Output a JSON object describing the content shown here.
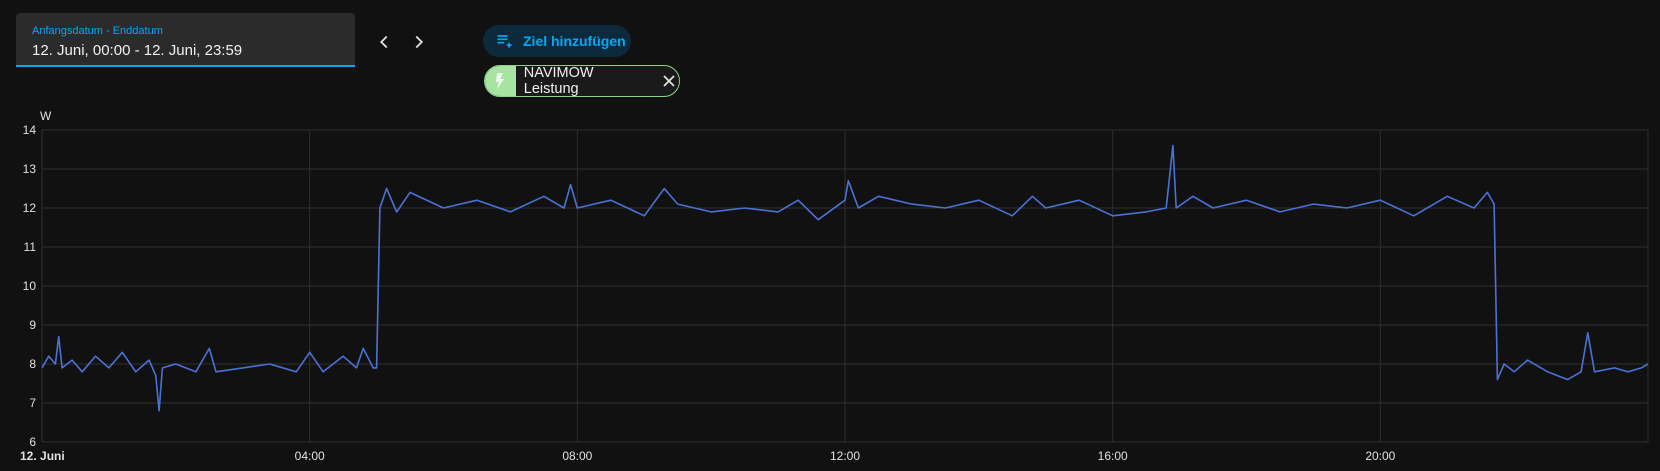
{
  "date_range": {
    "label": "Anfangsdatum - Enddatum",
    "value": "12. Juni, 00:00 - 12. Juni, 23:59"
  },
  "toolbar": {
    "add_target_label": "Ziel hinzufügen"
  },
  "entity_chip": {
    "label": "NAVIMOW Leistung",
    "color": "#a7e3a2"
  },
  "colors": {
    "accent": "#03a9f4",
    "series": "#4a72d6",
    "grid": "#2e2e2e"
  },
  "chart_data": {
    "type": "line",
    "ylabel": "W",
    "ylim": [
      6,
      14
    ],
    "yticks": [
      "6",
      "7",
      "8",
      "9",
      "10",
      "11",
      "12",
      "13",
      "14"
    ],
    "xlim": [
      0,
      24
    ],
    "xticks": [
      {
        "hour": 0,
        "label": "12. Juni",
        "bold": true
      },
      {
        "hour": 4,
        "label": "04:00"
      },
      {
        "hour": 8,
        "label": "08:00"
      },
      {
        "hour": 12,
        "label": "12:00"
      },
      {
        "hour": 16,
        "label": "16:00"
      },
      {
        "hour": 20,
        "label": "20:00"
      }
    ],
    "grid": true,
    "series": [
      {
        "values": [
          [
            0.0,
            7.9
          ],
          [
            0.1,
            8.2
          ],
          [
            0.2,
            8.0
          ],
          [
            0.25,
            8.7
          ],
          [
            0.3,
            7.9
          ],
          [
            0.45,
            8.1
          ],
          [
            0.6,
            7.8
          ],
          [
            0.8,
            8.2
          ],
          [
            1.0,
            7.9
          ],
          [
            1.2,
            8.3
          ],
          [
            1.4,
            7.8
          ],
          [
            1.6,
            8.1
          ],
          [
            1.7,
            7.7
          ],
          [
            1.75,
            6.8
          ],
          [
            1.8,
            7.9
          ],
          [
            2.0,
            8.0
          ],
          [
            2.3,
            7.8
          ],
          [
            2.5,
            8.4
          ],
          [
            2.6,
            7.8
          ],
          [
            3.0,
            7.9
          ],
          [
            3.4,
            8.0
          ],
          [
            3.8,
            7.8
          ],
          [
            4.0,
            8.3
          ],
          [
            4.2,
            7.8
          ],
          [
            4.5,
            8.2
          ],
          [
            4.7,
            7.9
          ],
          [
            4.8,
            8.4
          ],
          [
            4.95,
            7.9
          ],
          [
            5.0,
            7.9
          ],
          [
            5.05,
            12.0
          ],
          [
            5.15,
            12.5
          ],
          [
            5.3,
            11.9
          ],
          [
            5.5,
            12.4
          ],
          [
            6.0,
            12.0
          ],
          [
            6.5,
            12.2
          ],
          [
            7.0,
            11.9
          ],
          [
            7.5,
            12.3
          ],
          [
            7.8,
            12.0
          ],
          [
            7.9,
            12.6
          ],
          [
            8.0,
            12.0
          ],
          [
            8.5,
            12.2
          ],
          [
            9.0,
            11.8
          ],
          [
            9.3,
            12.5
          ],
          [
            9.5,
            12.1
          ],
          [
            10.0,
            11.9
          ],
          [
            10.5,
            12.0
          ],
          [
            11.0,
            11.9
          ],
          [
            11.3,
            12.2
          ],
          [
            11.6,
            11.7
          ],
          [
            12.0,
            12.2
          ],
          [
            12.05,
            12.7
          ],
          [
            12.2,
            12.0
          ],
          [
            12.5,
            12.3
          ],
          [
            13.0,
            12.1
          ],
          [
            13.5,
            12.0
          ],
          [
            14.0,
            12.2
          ],
          [
            14.5,
            11.8
          ],
          [
            14.8,
            12.3
          ],
          [
            15.0,
            12.0
          ],
          [
            15.5,
            12.2
          ],
          [
            16.0,
            11.8
          ],
          [
            16.5,
            11.9
          ],
          [
            16.8,
            12.0
          ],
          [
            16.9,
            13.6
          ],
          [
            16.95,
            12.0
          ],
          [
            17.2,
            12.3
          ],
          [
            17.5,
            12.0
          ],
          [
            18.0,
            12.2
          ],
          [
            18.5,
            11.9
          ],
          [
            19.0,
            12.1
          ],
          [
            19.5,
            12.0
          ],
          [
            20.0,
            12.2
          ],
          [
            20.5,
            11.8
          ],
          [
            21.0,
            12.3
          ],
          [
            21.4,
            12.0
          ],
          [
            21.6,
            12.4
          ],
          [
            21.7,
            12.1
          ],
          [
            21.75,
            7.6
          ],
          [
            21.85,
            8.0
          ],
          [
            22.0,
            7.8
          ],
          [
            22.2,
            8.1
          ],
          [
            22.5,
            7.8
          ],
          [
            22.8,
            7.6
          ],
          [
            23.0,
            7.8
          ],
          [
            23.1,
            8.8
          ],
          [
            23.2,
            7.8
          ],
          [
            23.5,
            7.9
          ],
          [
            23.7,
            7.8
          ],
          [
            23.9,
            7.9
          ],
          [
            24.0,
            8.0
          ]
        ]
      }
    ]
  }
}
